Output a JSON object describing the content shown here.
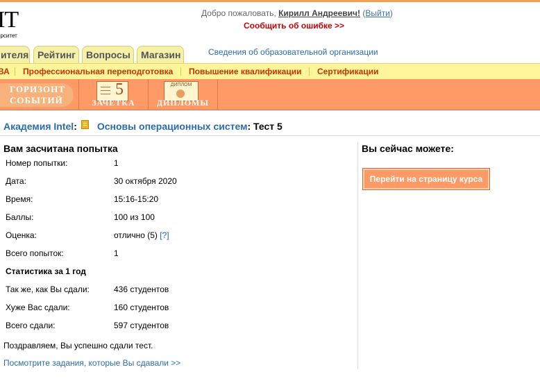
{
  "header": {
    "logo_letters": "IT",
    "logo_sub": "ерситет",
    "welcome_prefix": "Добро пожаловать, ",
    "user_name": "Кирилл Андреевич!",
    "logout_open": " (",
    "logout_label": "Выйти",
    "logout_close": ")",
    "report_error": "Сообщить об ошибке >>"
  },
  "tabs": [
    {
      "label": "ителя"
    },
    {
      "label": "Рейтинг"
    },
    {
      "label": "Вопросы"
    },
    {
      "label": "Магазин"
    }
  ],
  "org_info_link": "Сведения об образовательной организации",
  "yellow_nav": [
    {
      "label": "ВА"
    },
    {
      "label": "Профессиональная переподготовка"
    },
    {
      "label": "Повышение квалификации"
    },
    {
      "label": "Сертификации"
    }
  ],
  "banner": {
    "horizon_line1": "ГОРИЗОНТ",
    "horizon_line2": "СОБЫТИЙ",
    "zachetka_label": "ЗАЧЕТКА",
    "zachetka_num": "5",
    "diplomas_label": "ДИПЛОМЫ",
    "diploma_icon_text": "ДИПЛОМ"
  },
  "breadcrumb": {
    "root": "Академия Intel",
    "colon": ":",
    "course": "Основы операционных систем",
    "test": ": Тест 5"
  },
  "result": {
    "title": "Вам засчитана попытка",
    "rows": [
      {
        "label": "Номер попытки:",
        "value": "1"
      },
      {
        "label": "Дата:",
        "value": "30 октября 2020"
      },
      {
        "label": "Время:",
        "value": "15:16-15:20"
      },
      {
        "label": "Баллы:",
        "value": "100 из 100"
      },
      {
        "label": "Оценка:",
        "value": "отлично (5)",
        "help": "[?]"
      },
      {
        "label": "Всего попыток:",
        "value": "1"
      }
    ],
    "stats_title": "Статистика за 1 год",
    "stats": [
      {
        "label": "Так же, как Вы сдали:",
        "value": "436 студентов"
      },
      {
        "label": "Хуже Вас сдали:",
        "value": "160 студентов"
      },
      {
        "label": "Всего сдали:",
        "value": "597 студентов"
      }
    ],
    "congrats": "Поздравляем, Вы успешно сдали тест.",
    "review_link": "Посмотрите задания, которые Вы сдавали >>"
  },
  "sidebar": {
    "title": "Вы сейчас можете:",
    "course_button": "Перейти на страницу курса"
  }
}
